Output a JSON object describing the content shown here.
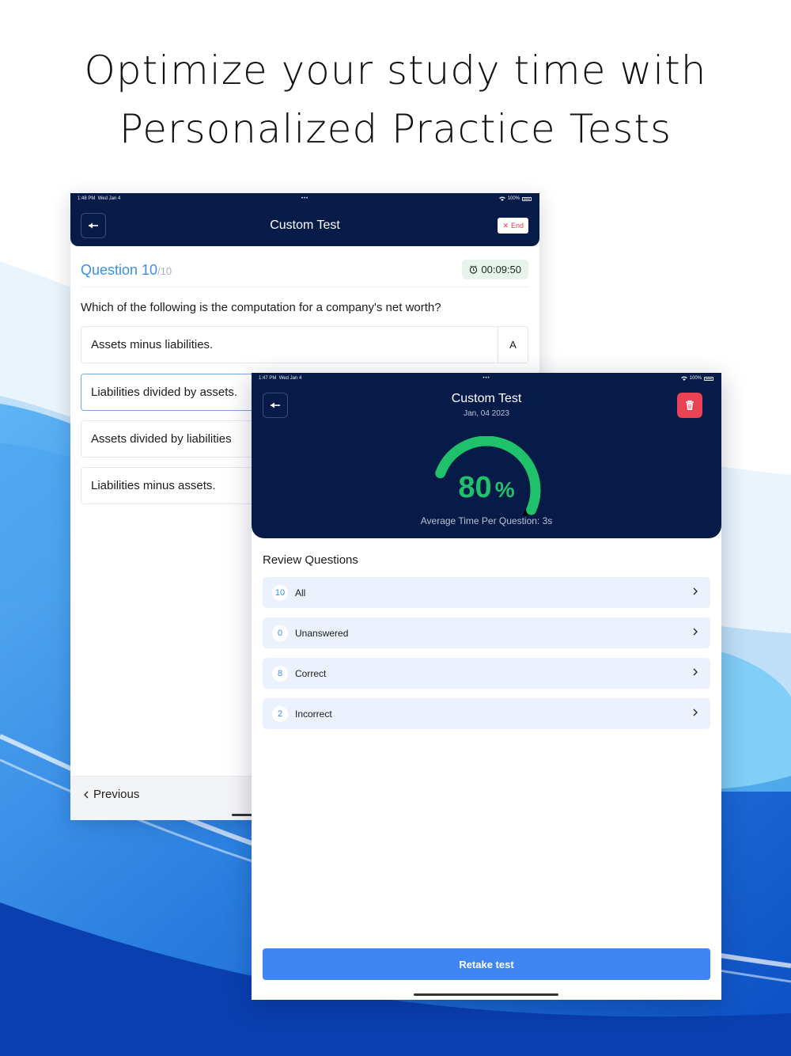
{
  "headline": {
    "line1": "Optimize your study time with",
    "line2": "Personalized Practice Tests"
  },
  "colors": {
    "navy": "#061b47",
    "accent_blue": "#3f86f2",
    "success_green": "#1fc26b",
    "danger_red": "#e84354"
  },
  "question_screen": {
    "status_time": "1:48 PM",
    "status_date": "Wed Jan 4",
    "status_dots": "•••",
    "battery": "100%",
    "title": "Custom Test",
    "end_label": "End",
    "question_label": "Question 10",
    "question_total": "/10",
    "timer": "00:09:50",
    "question_text": "Which of the following is the computation for a company's net worth?",
    "options": [
      {
        "text": "Assets minus liabilities.",
        "letter": "A"
      },
      {
        "text": "Liabilities divided by assets."
      },
      {
        "text": "Assets divided by liabilities"
      },
      {
        "text": "Liabilities minus assets."
      }
    ],
    "previous_label": "Previous",
    "icons": {
      "back": "back-arrow-icon",
      "close": "close-icon",
      "clock": "clock-icon",
      "chevron": "chevron-left-icon"
    }
  },
  "results_screen": {
    "status_time": "1:47 PM",
    "status_date": "Wed Jan 4",
    "status_dots": "•••",
    "battery": "100%",
    "title": "Custom Test",
    "date": "Jan, 04 2023",
    "score": 80,
    "score_text": "80",
    "score_unit": "%",
    "avg_time": "Average Time Per Question: 3s",
    "review_title": "Review Questions",
    "review_items": [
      {
        "count": "10",
        "label": "All"
      },
      {
        "count": "0",
        "label": "Unanswered"
      },
      {
        "count": "8",
        "label": "Correct"
      },
      {
        "count": "2",
        "label": "Incorrect"
      }
    ],
    "retake_label": "Retake test",
    "icons": {
      "back": "back-arrow-icon",
      "trash": "trash-icon",
      "chevron": "chevron-right-icon"
    }
  }
}
